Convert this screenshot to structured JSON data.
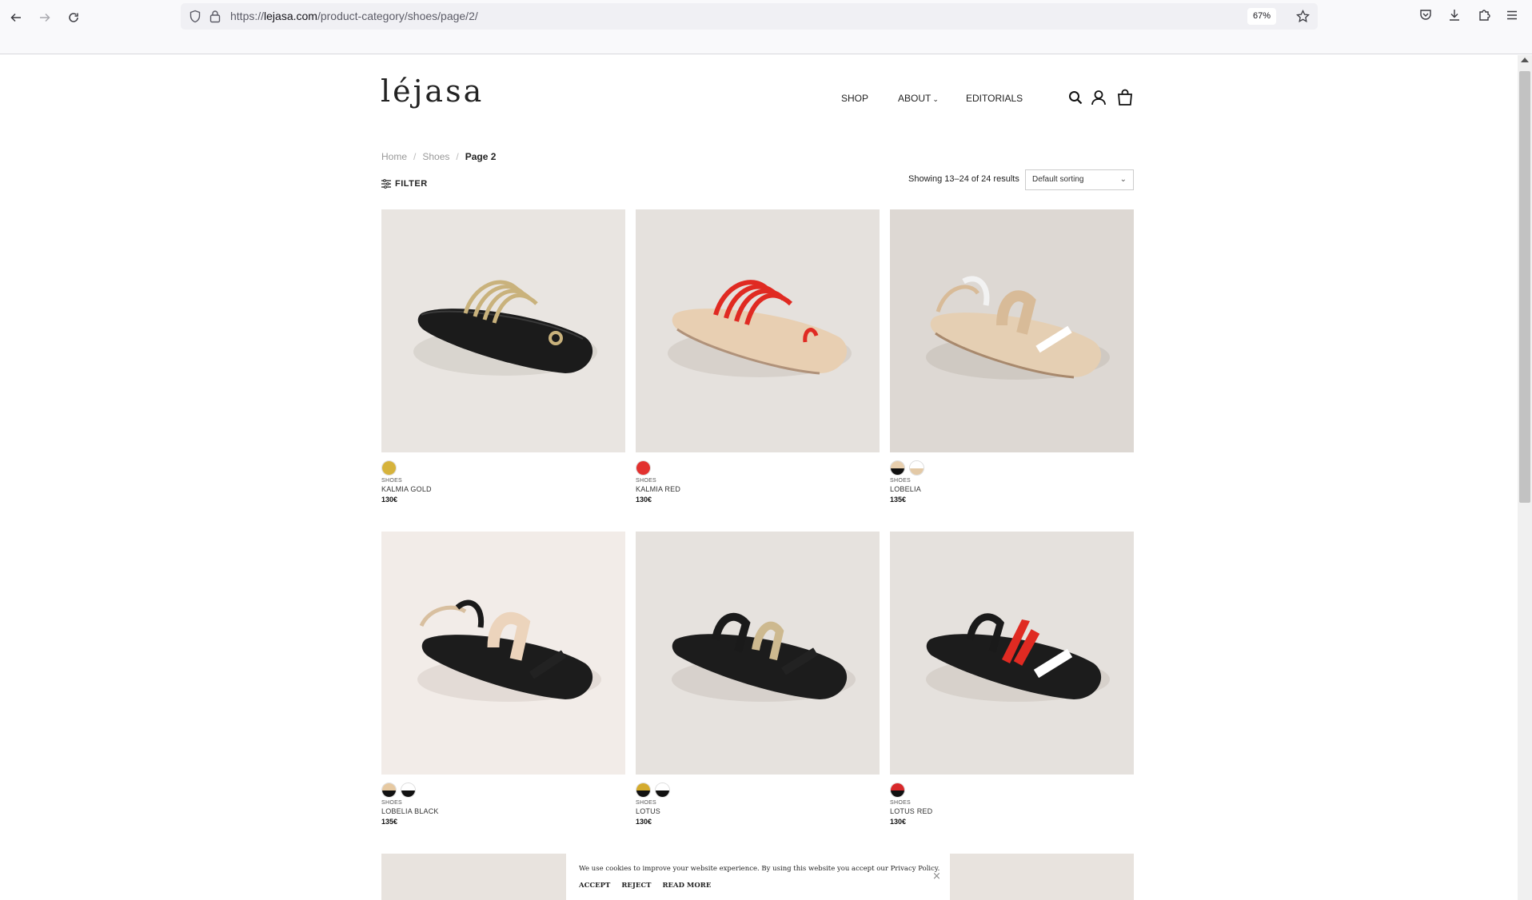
{
  "browser": {
    "url_prefix": "https://",
    "url_host": "lejasa.com",
    "url_path": "/product-category/shoes/page/2/",
    "zoom": "67%"
  },
  "site": {
    "logo": "léjasa",
    "nav": {
      "shop": "SHOP",
      "about": "ABOUT",
      "editorials": "EDITORIALS"
    }
  },
  "breadcrumb": {
    "home": "Home",
    "sep1": "/",
    "shoes": "Shoes",
    "sep2": "/",
    "current": "Page 2"
  },
  "toolbar": {
    "filter": "FILTER",
    "results": "Showing 13–24 of 24 results",
    "sort_selected": "Default sorting"
  },
  "products": [
    {
      "category": "SHOES",
      "name": "KALMIA GOLD",
      "price": "130€",
      "swatches": [
        [
          "#d6b33c",
          "#d6b33c"
        ]
      ]
    },
    {
      "category": "SHOES",
      "name": "KALMIA RED",
      "price": "130€",
      "swatches": [
        [
          "#e2312f",
          "#e2312f"
        ]
      ]
    },
    {
      "category": "SHOES",
      "name": "LOBELIA",
      "price": "135€",
      "swatches": [
        [
          "#e8cfae",
          "#111111"
        ],
        [
          "#ffffff",
          "#e3c9a6"
        ]
      ]
    },
    {
      "category": "SHOES",
      "name": "LOBELIA BLACK",
      "price": "135€",
      "swatches": [
        [
          "#e6c9a2",
          "#111111"
        ],
        [
          "#ffffff",
          "#111111"
        ]
      ]
    },
    {
      "category": "SHOES",
      "name": "LOTUS",
      "price": "130€",
      "swatches": [
        [
          "#d4ab2e",
          "#111111"
        ],
        [
          "#ffffff",
          "#111111"
        ]
      ]
    },
    {
      "category": "SHOES",
      "name": "LOTUS RED",
      "price": "130€",
      "swatches": [
        [
          "#d8282a",
          "#111111"
        ]
      ]
    }
  ],
  "cookie": {
    "message": "We use cookies to improve your website experience. By using this website you accept our Privacy Policy.",
    "accept": "ACCEPT",
    "reject": "REJECT",
    "read_more": "READ MORE",
    "close": "×"
  },
  "icons": {
    "back": "arrow-left-icon",
    "forward": "arrow-right-icon",
    "reload": "reload-icon",
    "shield": "shield-icon",
    "lock": "lock-icon",
    "bookmark": "star-icon",
    "pocket": "pocket-icon",
    "downloads": "download-icon",
    "extensions": "puzzle-icon",
    "menu": "hamburger-menu-icon",
    "search": "search-icon",
    "account": "user-icon",
    "cart": "shopping-bag-icon"
  }
}
